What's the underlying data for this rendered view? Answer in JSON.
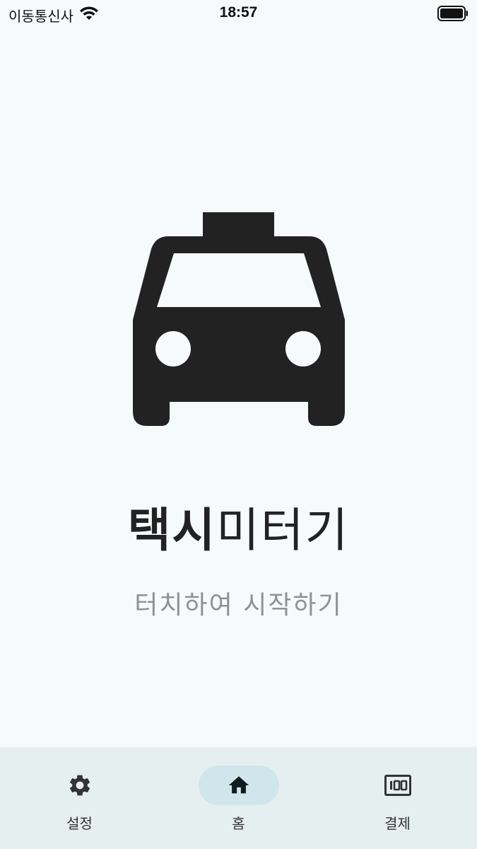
{
  "status_bar": {
    "carrier": "이동통신사",
    "time": "18:57",
    "wifi_icon": "wifi-icon",
    "battery_icon": "battery-icon"
  },
  "main": {
    "icon": "taxi-icon",
    "title_bold": "택시",
    "title_light": "미터기",
    "subtitle": "터치하여 시작하기"
  },
  "bottom_nav": {
    "items": [
      {
        "label": "설정",
        "icon": "gear-icon",
        "active": false
      },
      {
        "label": "홈",
        "icon": "home-icon",
        "active": true
      },
      {
        "label": "결제",
        "icon": "payment-icon",
        "active": false
      }
    ]
  },
  "colors": {
    "background": "#f6fafa",
    "nav_background": "#e6efef",
    "active_pill": "#cfe6ec",
    "icon_dark": "#222222",
    "subtitle_gray": "#8e9292"
  }
}
